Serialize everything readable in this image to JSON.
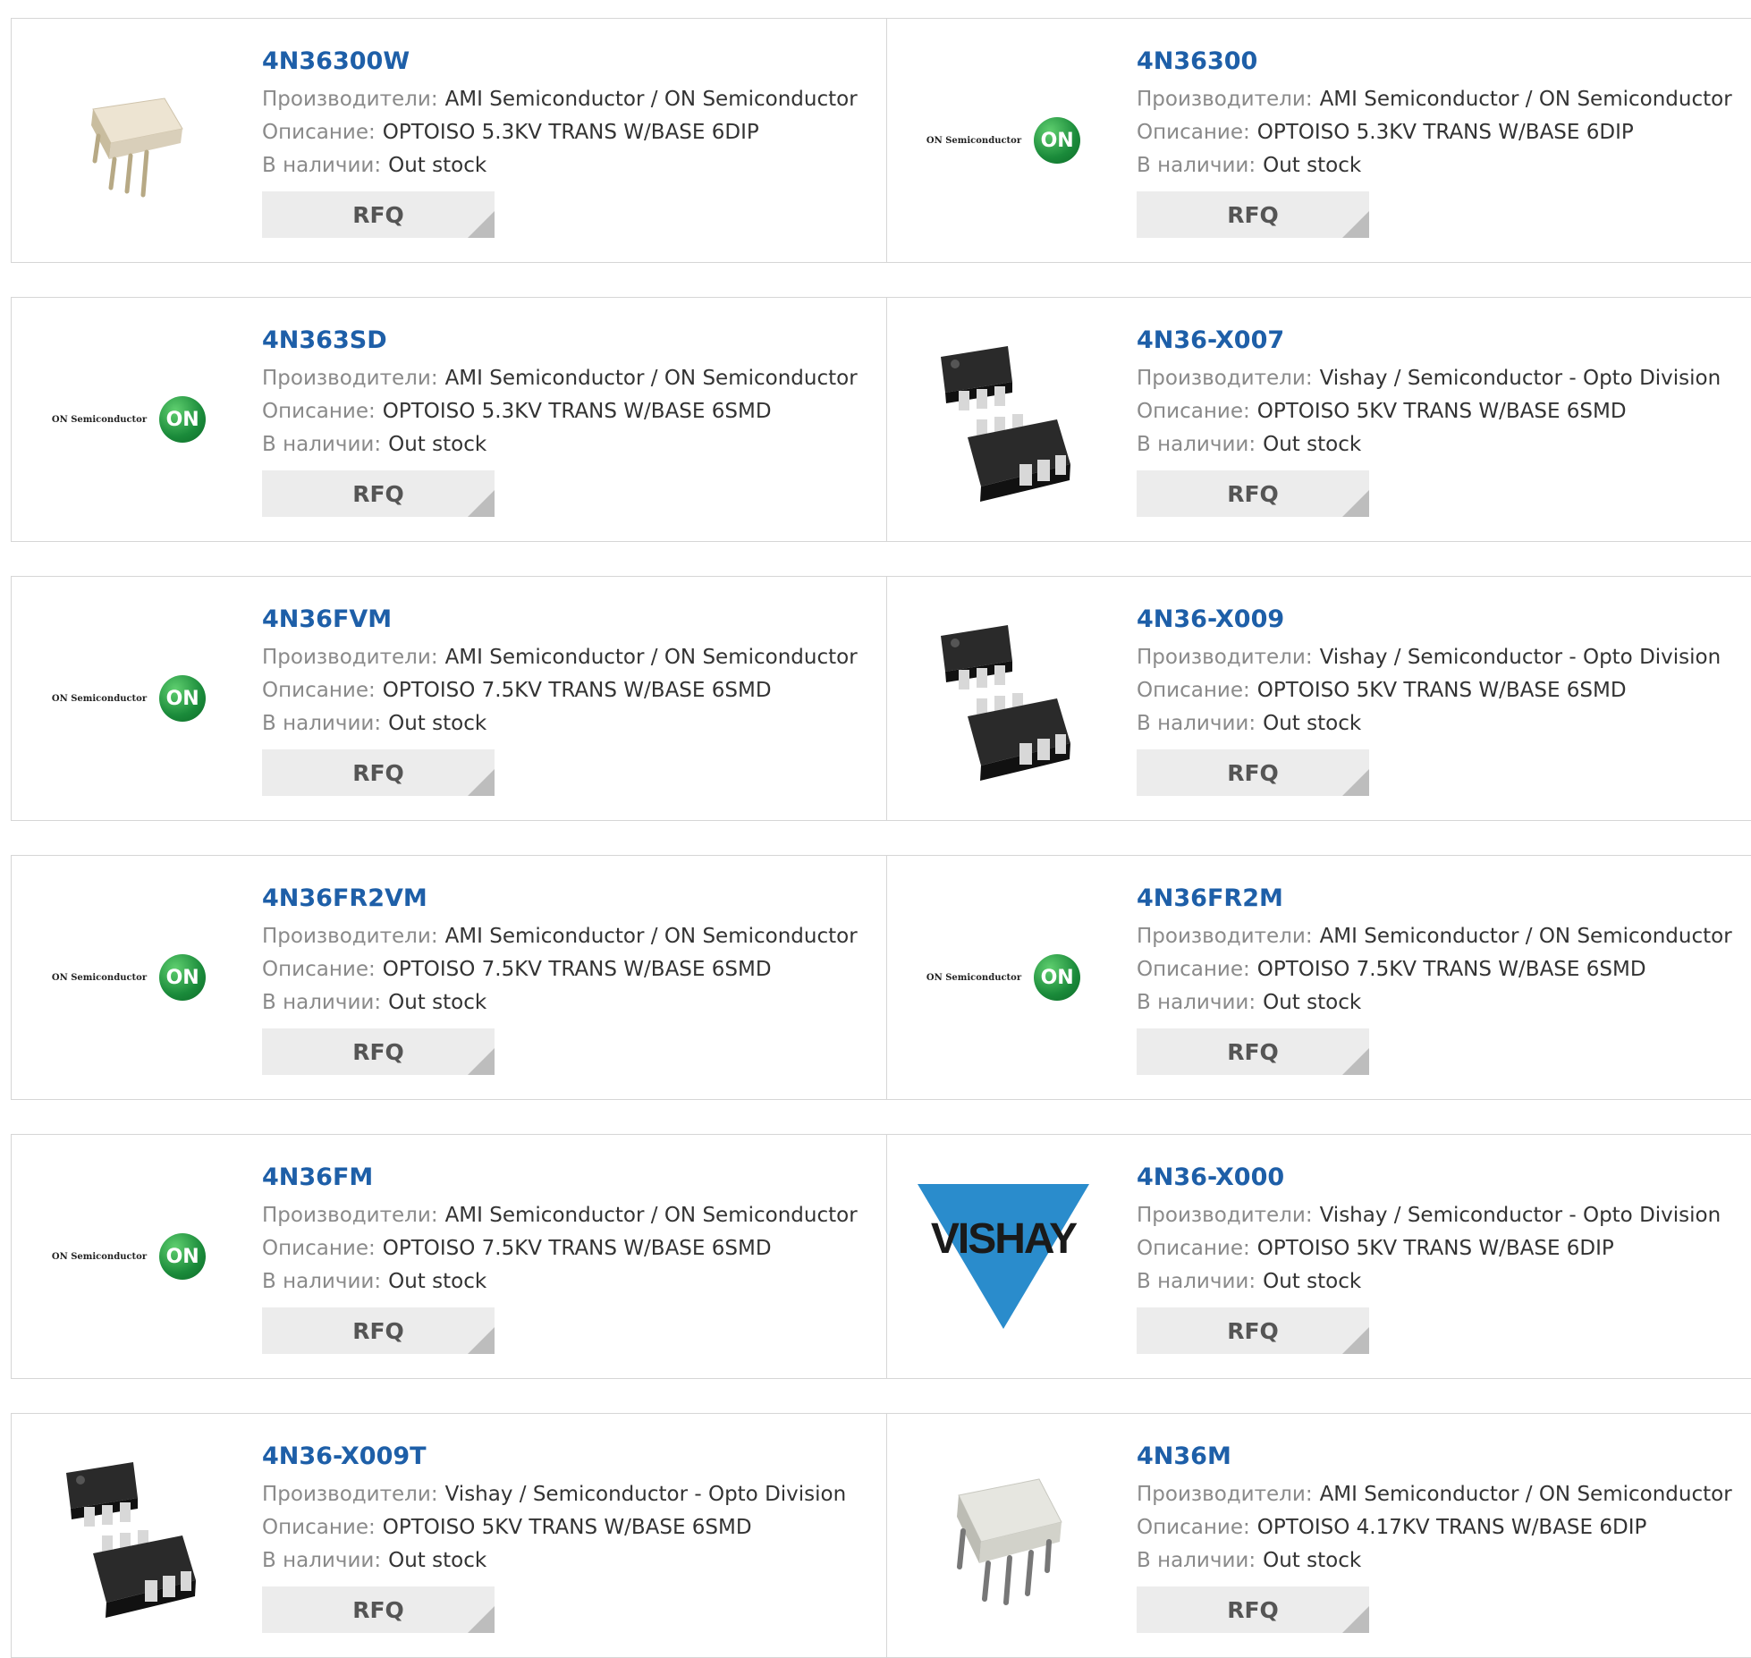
{
  "labels": {
    "manufacturer": "Производители:",
    "description": "Описание:",
    "stock": "В наличии:",
    "rfq": "RFQ"
  },
  "brand_text": {
    "on_semi": "ON Semiconductor",
    "on_badge": "ON",
    "vishay": "VISHAY"
  },
  "colors": {
    "part_link": "#1e5fa8",
    "on_green": "#1a8a3a",
    "vishay_blue": "#2a8ccc"
  },
  "products": [
    {
      "part": "4N36300W",
      "manufacturer": "AMI Semiconductor / ON Semiconductor",
      "description": "OPTOISO 5.3KV TRANS W/BASE 6DIP",
      "stock": "Out stock",
      "image": "dip-white-icon"
    },
    {
      "part": "4N36300",
      "manufacturer": "AMI Semiconductor / ON Semiconductor",
      "description": "OPTOISO 5.3KV TRANS W/BASE 6DIP",
      "stock": "Out stock",
      "image": "on-semi-logo"
    },
    {
      "part": "4N363SD",
      "manufacturer": "AMI Semiconductor / ON Semiconductor",
      "description": "OPTOISO 5.3KV TRANS W/BASE 6SMD",
      "stock": "Out stock",
      "image": "on-semi-logo"
    },
    {
      "part": "4N36-X007",
      "manufacturer": "Vishay / Semiconductor - Opto Division",
      "description": "OPTOISO 5KV TRANS W/BASE 6SMD",
      "stock": "Out stock",
      "image": "smd-black-icon"
    },
    {
      "part": "4N36FVM",
      "manufacturer": "AMI Semiconductor / ON Semiconductor",
      "description": "OPTOISO 7.5KV TRANS W/BASE 6SMD",
      "stock": "Out stock",
      "image": "on-semi-logo"
    },
    {
      "part": "4N36-X009",
      "manufacturer": "Vishay / Semiconductor - Opto Division",
      "description": "OPTOISO 5KV TRANS W/BASE 6SMD",
      "stock": "Out stock",
      "image": "smd-black-icon"
    },
    {
      "part": "4N36FR2VM",
      "manufacturer": "AMI Semiconductor / ON Semiconductor",
      "description": "OPTOISO 7.5KV TRANS W/BASE 6SMD",
      "stock": "Out stock",
      "image": "on-semi-logo"
    },
    {
      "part": "4N36FR2M",
      "manufacturer": "AMI Semiconductor / ON Semiconductor",
      "description": "OPTOISO 7.5KV TRANS W/BASE 6SMD",
      "stock": "Out stock",
      "image": "on-semi-logo"
    },
    {
      "part": "4N36FM",
      "manufacturer": "AMI Semiconductor / ON Semiconductor",
      "description": "OPTOISO 7.5KV TRANS W/BASE 6SMD",
      "stock": "Out stock",
      "image": "on-semi-logo"
    },
    {
      "part": "4N36-X000",
      "manufacturer": "Vishay / Semiconductor - Opto Division",
      "description": "OPTOISO 5KV TRANS W/BASE 6DIP",
      "stock": "Out stock",
      "image": "vishay-logo"
    },
    {
      "part": "4N36-X009T",
      "manufacturer": "Vishay / Semiconductor - Opto Division",
      "description": "OPTOISO 5KV TRANS W/BASE 6SMD",
      "stock": "Out stock",
      "image": "smd-black-icon"
    },
    {
      "part": "4N36M",
      "manufacturer": "AMI Semiconductor / ON Semiconductor",
      "description": "OPTOISO 4.17KV TRANS W/BASE 6DIP",
      "stock": "Out stock",
      "image": "dip-grey-icon"
    }
  ]
}
